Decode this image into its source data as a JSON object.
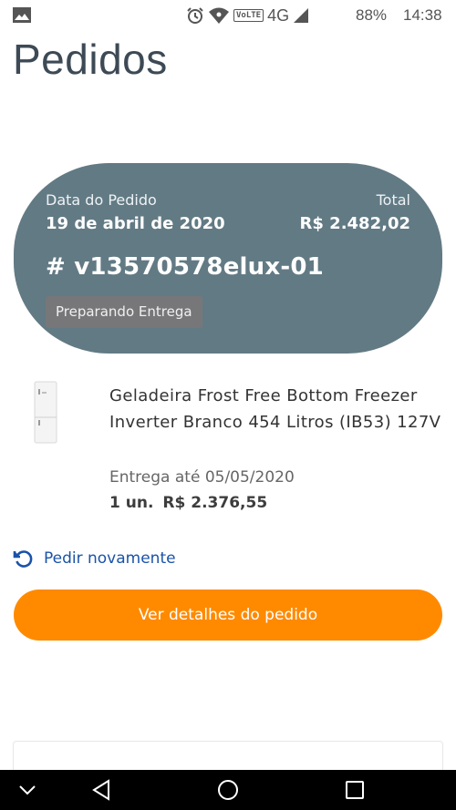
{
  "status_bar": {
    "network": "4G",
    "volte": "VoLTE",
    "battery": "88%",
    "time": "14:38"
  },
  "page": {
    "title": "Pedidos"
  },
  "order": {
    "date_label": "Data do Pedido",
    "date_value": "19 de abril de 2020",
    "total_label": "Total",
    "total_value": "R$ 2.482,02",
    "order_id": "# v13570578elux-01",
    "status": "Preparando Entrega"
  },
  "product": {
    "name": "Geladeira Frost Free Bottom Freezer Inverter Branco 454 Litros (IB53) 127V",
    "delivery": "Entrega até 05/05/2020",
    "quantity": "1 un.",
    "price": "R$ 2.376,55"
  },
  "actions": {
    "reorder_label": "Pedir novamente",
    "details_label": "Ver detalhes do pedido"
  },
  "colors": {
    "card_background": "#627a84",
    "primary_button": "#ff8a00",
    "link": "#1a53a8",
    "status_badge": "#77777a"
  },
  "icons": {
    "status_left": "gallery-icon",
    "status_right": [
      "alarm-icon",
      "wifi-icon",
      "signal-icon"
    ],
    "reorder": "reorder-icon",
    "nav": [
      "nav-collapse-icon",
      "nav-back-icon",
      "nav-home-icon",
      "nav-recents-icon"
    ]
  }
}
